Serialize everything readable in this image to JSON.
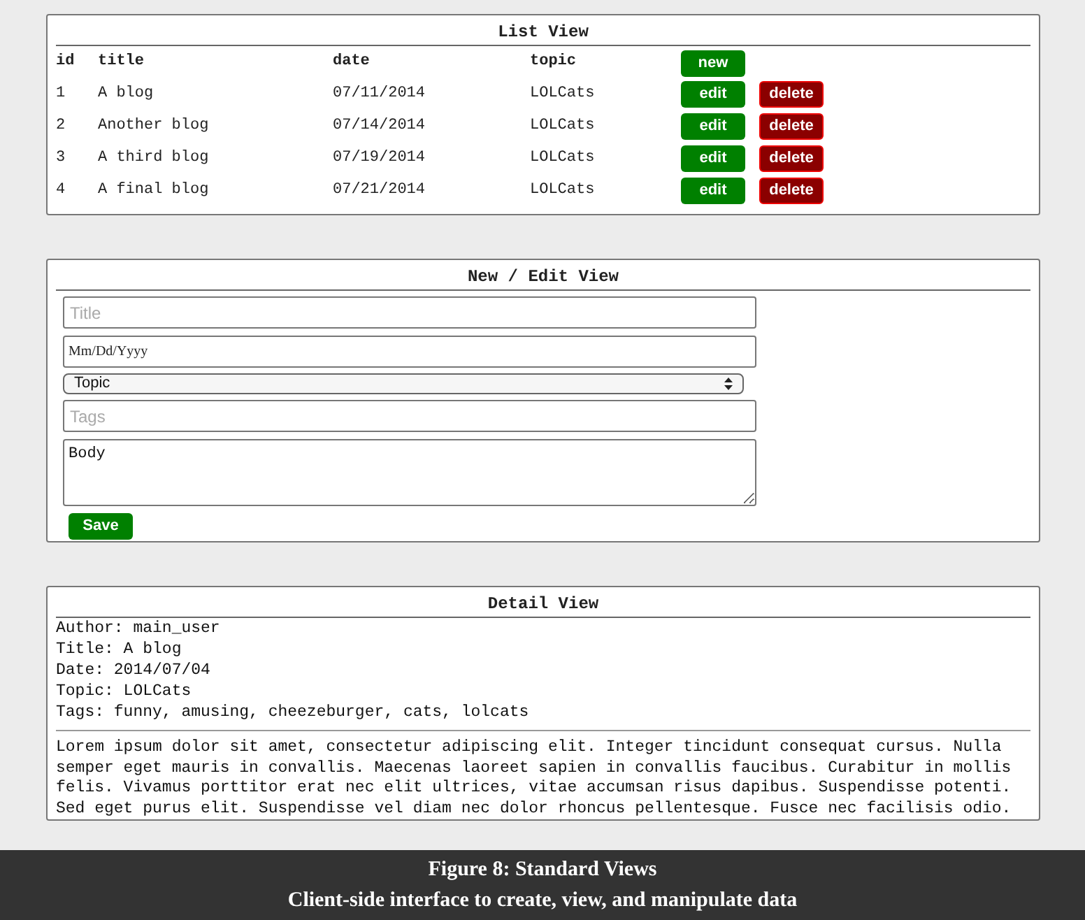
{
  "list_view": {
    "title": "List View",
    "columns": [
      "id",
      "title",
      "date",
      "topic"
    ],
    "new_button": "new",
    "rows": [
      {
        "id": "1",
        "title": "A blog",
        "date": "07/11/2014",
        "topic": "LOLCats",
        "edit": "edit",
        "delete": "delete"
      },
      {
        "id": "2",
        "title": "Another blog",
        "date": "07/14/2014",
        "topic": "LOLCats",
        "edit": "edit",
        "delete": "delete"
      },
      {
        "id": "3",
        "title": "A third blog",
        "date": "07/19/2014",
        "topic": "LOLCats",
        "edit": "edit",
        "delete": "delete"
      },
      {
        "id": "4",
        "title": "A final blog",
        "date": "07/21/2014",
        "topic": "LOLCats",
        "edit": "edit",
        "delete": "delete"
      }
    ]
  },
  "edit_view": {
    "title": "New / Edit View",
    "title_field": {
      "placeholder": "Title"
    },
    "date_field": {
      "placeholder": "Mm/Dd/Yyyy"
    },
    "topic_select": {
      "value": "Topic"
    },
    "tags_field": {
      "placeholder": "Tags"
    },
    "body_field": {
      "value": "Body"
    },
    "save_button": "Save"
  },
  "detail_view": {
    "title": "Detail View",
    "fields": [
      "Author: main_user",
      "Title: A blog",
      "Date: 2014/07/04",
      "Topic: LOLCats",
      "Tags: funny, amusing, cheezeburger, cats, lolcats"
    ],
    "body": "Lorem ipsum dolor sit amet, consectetur adipiscing elit. Integer tincidunt consequat cursus. Nulla semper eget mauris in convallis. Maecenas laoreet sapien in convallis faucibus. Curabitur in mollis felis. Vivamus porttitor erat nec elit ultrices, vitae accumsan risus dapibus. Suspendisse potenti. Sed eget purus elit. Suspendisse vel diam nec dolor rhoncus pellentesque. Fusce nec facilisis odio."
  },
  "caption": {
    "title": "Figure 8: Standard Views",
    "subtitle": "Client-side interface to create, view, and manipulate data"
  }
}
